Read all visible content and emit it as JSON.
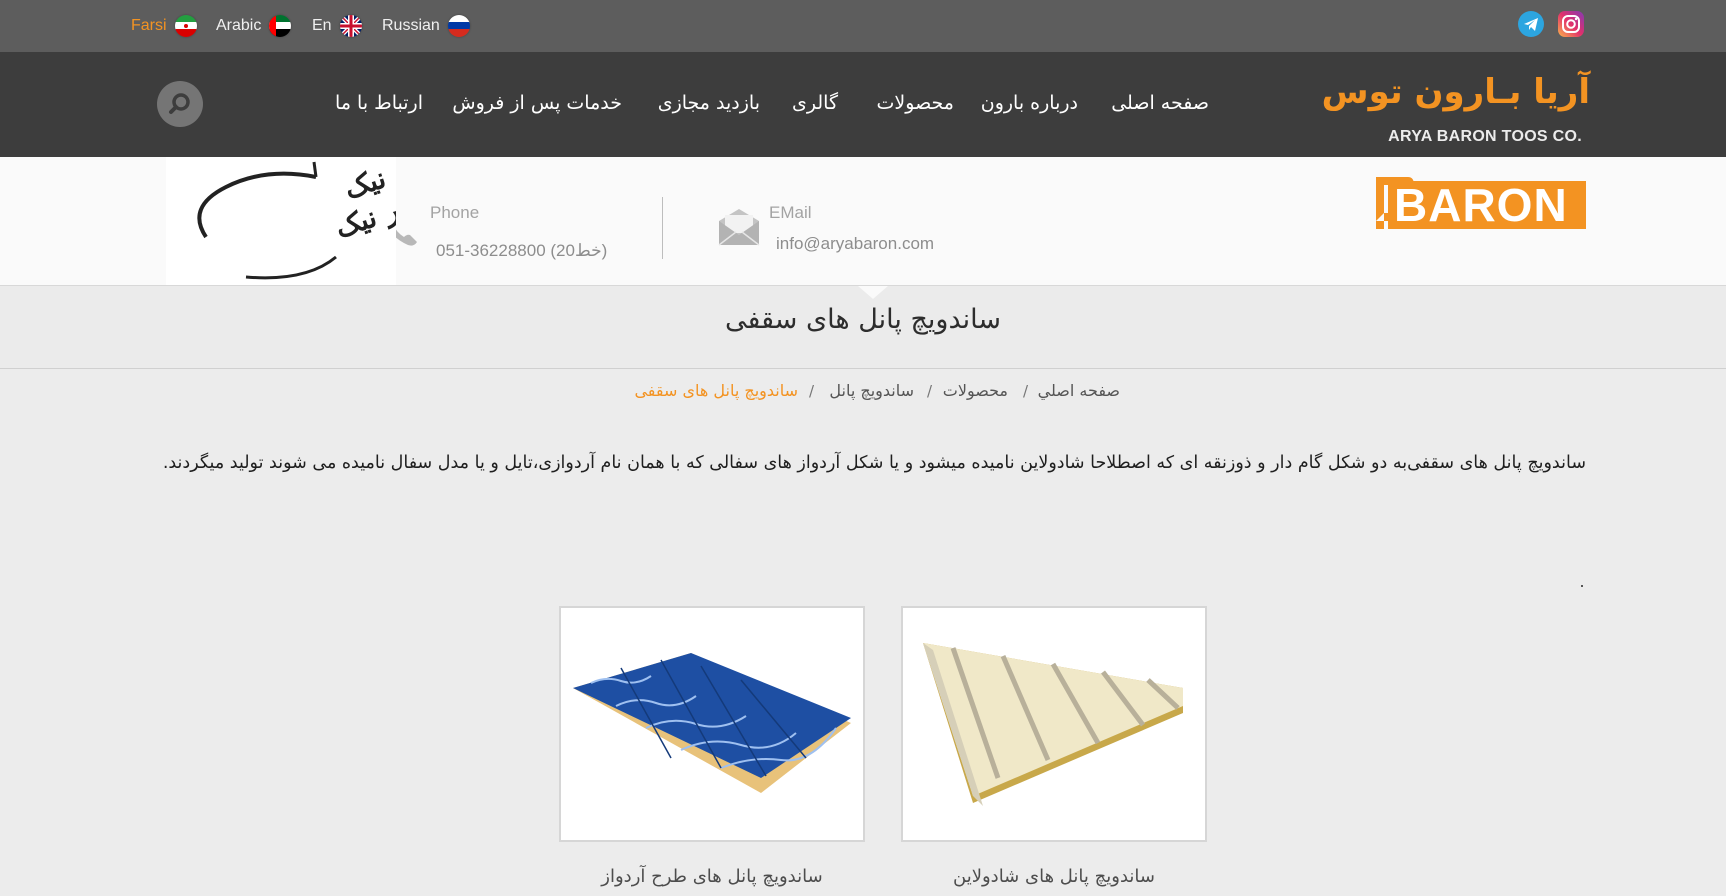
{
  "topbar": {
    "languages": [
      {
        "label": "Farsi",
        "active": true
      },
      {
        "label": "Arabic",
        "active": false
      },
      {
        "label": "En",
        "active": false
      },
      {
        "label": "Russian",
        "active": false
      }
    ],
    "social_icons": [
      "telegram-icon",
      "instagram-icon"
    ],
    "accent_color": "#f39322"
  },
  "nav": {
    "logo_fa": "آریا بـارون توس",
    "logo_en": "ARYA BARON TOOS CO.",
    "menu": [
      "صفحه اصلی",
      "درباره بارون",
      "محصولات",
      "گالری",
      "بازدید مجازی",
      "خدمات پس از فروش",
      "ارتباط با ما"
    ],
    "search_icon": "search-icon"
  },
  "header": {
    "brand_logo": "BARON",
    "email_label": "EMail",
    "email_value": "info@aryabaron.com",
    "phone_label": "Phone",
    "phone_value": "051-36228800 (20خط)",
    "signature_text": "پایدار نیک ماندگار نیک"
  },
  "page": {
    "title": "ساندویچ پانل های سقفی",
    "breadcrumb": [
      "صفحه اصلي",
      "محصولات",
      "ساندويچ پانل",
      "ساندويچ پانل هاى سقفى"
    ],
    "breadcrumb_separator": "/",
    "description": "ساندویچ پانل های سقفی‌به دو شکل گام دار و ذوزنقه ای که اصطلاحا شادولاین نامیده میشود و یا شکل آردواز های سفالی که با همان نام آردوازی،تایل و یا مدل سفال نامیده می شوند تولید میگردند.",
    "dot": "."
  },
  "products": [
    {
      "caption": "ساندویچ پانل های شادولاین",
      "image": "trapezoidal-panel"
    },
    {
      "caption": "ساندویچ پانل های طرح آردواز",
      "image": "tile-panel"
    }
  ]
}
